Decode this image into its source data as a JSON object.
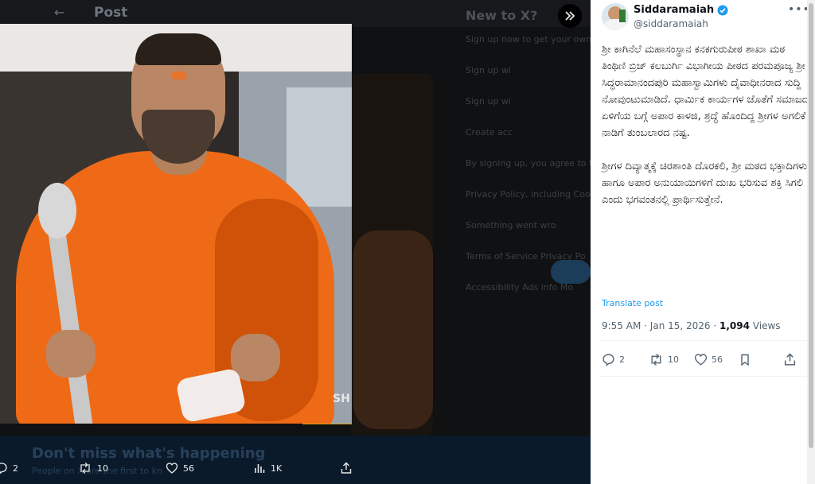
{
  "header": {
    "back_label": "←",
    "title": "Post"
  },
  "background_sidebar": {
    "heading": "New to X?",
    "lines": [
      "Sign up now to get your own",
      "Sign up wi",
      "Sign up wi",
      "Create acc",
      "By signing up, you agree to th",
      "Privacy Policy, including Coo",
      "Something went wro",
      "Terms of Service  Privacy Po",
      "Accessibility  Ads info  Mo"
    ]
  },
  "background_banner": {
    "title": "Don't miss what's happening",
    "subtitle": "People on X are the first to kn"
  },
  "media": {
    "watermark": "SH"
  },
  "dark_actions": {
    "replies": "2",
    "reposts": "10",
    "likes": "56",
    "views": "1K"
  },
  "post": {
    "display_name": "Siddaramaiah",
    "handle": "@siddaramaiah",
    "text": "ಶ್ರೀ ಕಾಗಿನೆಲೆ ಮಹಾಸಂಸ್ಥಾನ ಕನಕಗುರುಪೀಠ ಶಾಖಾ ಮಠ ತಿಂಥಿಣಿ ಬ್ರಿಜ್ ಕಲಬುರ್ಗಿ ವಿಭಾಗೀಯ ಪೀಠದ ಪರಮಪೂಜ್ಯ ಶ್ರೀ ಸಿದ್ಧರಾಮಾನಂದಪುರಿ ಮಹಾಸ್ವಾಮಿಗಳು ದೈವಾಧೀನರಾದ ಸುದ್ದಿ ನೋವುಂಟುಮಾಡಿದೆ. ಧಾರ್ಮಿಕ ಕಾರ್ಯಗಳ ಜೊತೆಗೆ ಸಮಾಜದ ಏಳಿಗೆಯ ಬಗ್ಗೆ ಅಪಾರ ಕಾಳಜಿ, ಶ್ರದ್ಧೆ ಹೊಂದಿದ್ದ ಶ್ರೀಗಳ ಅಗಲಿಕೆ ನಾಡಿಗೆ ತುಂಬಲಾರದ ನಷ್ಟ.\n\nಶ್ರೀಗಳ ದಿವ್ಯಾತ್ಮಕ್ಕೆ ಚಿರಶಾಂತಿ ದೊರಕಲಿ, ಶ್ರೀ ಮಠದ ಭಕ್ತಾದಿಗಳು ಹಾಗೂ ಅಪಾರ ಅನುಯಾಯಿಗಳಿಗೆ ದುಃಖ ಭರಿಸುವ ಶಕ್ತಿ ಸಿಗಲಿ ಎಂದು ಭಗವಂತನಲ್ಲಿ ಪ್ರಾರ್ಥಿಸುತ್ತೇನೆ.",
    "translate_label": "Translate post",
    "time": "9:55 AM",
    "date": "Jan 15, 2026",
    "views_count": "1,094",
    "views_label": "Views",
    "replies": "2",
    "reposts": "10",
    "likes": "56"
  },
  "colors": {
    "accent": "#1d9bf0",
    "verified": "#1d9bf0",
    "robe": "#ef6a16"
  }
}
